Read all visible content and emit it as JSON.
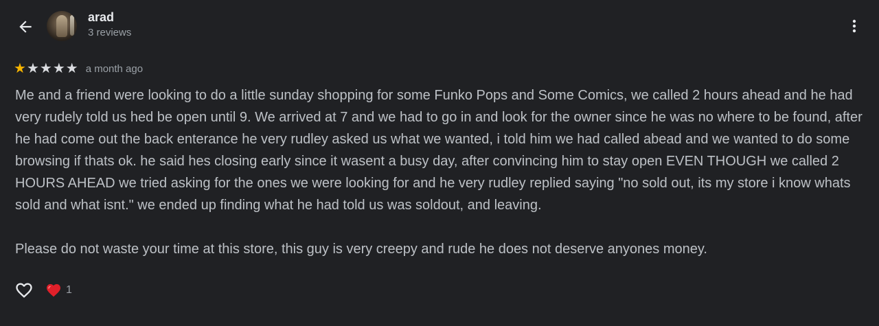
{
  "header": {
    "user_name": "arad",
    "review_count": "3 reviews"
  },
  "review": {
    "rating": 1,
    "max_rating": 5,
    "filled_star_color": "#f6b400",
    "empty_star_color": "#dadce0",
    "time": "a month ago",
    "text": "Me and a friend were looking to do a little sunday shopping for some Funko Pops and Some Comics, we called 2 hours ahead and he had very rudely told us hed be open until 9. We arrived at 7 and we had to go in and look for the owner since he was no where to be found, after he had come out the back enterance he very rudley asked us what we wanted, i told him we had called abead and we wanted to do some browsing if thats ok. he said hes closing early since it wasent a busy day, after convincing him to stay open EVEN THOUGH we called 2 HOURS AHEAD we tried asking for the ones we were looking for and he very rudley replied saying \"no sold out, its my store i know whats sold and what isnt.\" we ended up finding what he had told us was soldout, and leaving.\n\nPlease do not waste your time at this store, this guy is very creepy and rude he does not deserve anyones money."
  },
  "actions": {
    "like_icon": "heart-outline-icon",
    "reaction_icon": "red-heart-emoji",
    "reaction_count": "1"
  }
}
